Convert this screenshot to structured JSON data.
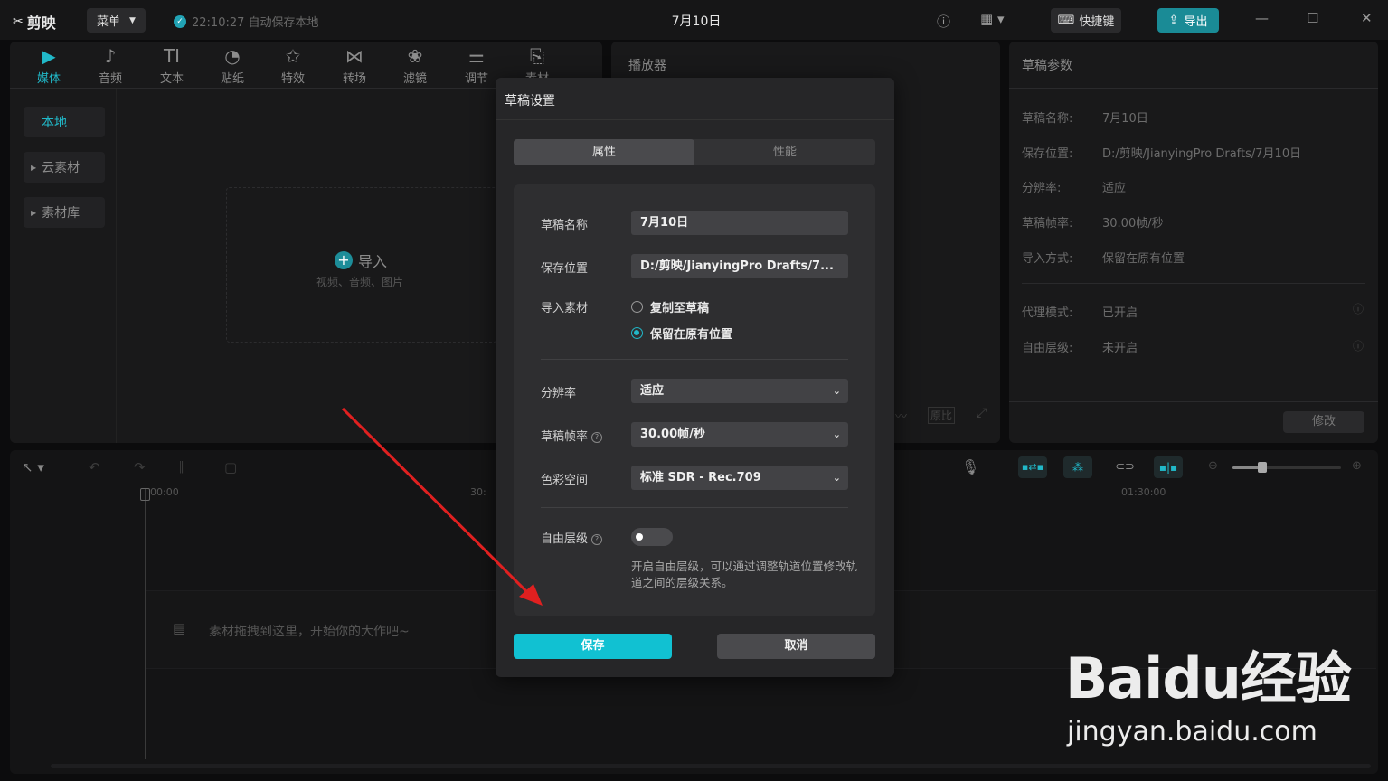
{
  "app": {
    "logo": "剪映",
    "menu": "菜单",
    "autosave": "22:10:27 自动保存本地",
    "title": "7月10日",
    "shortcut": "快捷键",
    "export": "导出"
  },
  "toolbar": [
    {
      "label": "媒体",
      "icon": "media-icon"
    },
    {
      "label": "音频",
      "icon": "audio-icon"
    },
    {
      "label": "文本",
      "icon": "text-icon"
    },
    {
      "label": "贴纸",
      "icon": "sticker-icon"
    },
    {
      "label": "特效",
      "icon": "effects-icon"
    },
    {
      "label": "转场",
      "icon": "transition-icon"
    },
    {
      "label": "滤镜",
      "icon": "filter-icon"
    },
    {
      "label": "调节",
      "icon": "adjust-icon"
    },
    {
      "label": "素材",
      "icon": "template-icon"
    }
  ],
  "sidebar": {
    "local": "本地",
    "cloud": "云素材",
    "library": "素材库"
  },
  "import": {
    "label": "导入",
    "hint": "视频、音频、图片"
  },
  "player": {
    "title": "播放器",
    "ratio": "原比"
  },
  "draft_params": {
    "title": "草稿参数",
    "rows": [
      {
        "k": "草稿名称:",
        "v": "7月10日"
      },
      {
        "k": "保存位置:",
        "v": "D:/剪映/JianyingPro Drafts/7月10日"
      },
      {
        "k": "分辨率:",
        "v": "适应"
      },
      {
        "k": "草稿帧率:",
        "v": "30.00帧/秒"
      },
      {
        "k": "导入方式:",
        "v": "保留在原有位置"
      },
      {
        "k": "代理模式:",
        "v": "已开启"
      },
      {
        "k": "自由层级:",
        "v": "未开启"
      }
    ],
    "modify": "修改"
  },
  "timeline": {
    "t0": "00:00",
    "t1": "30:",
    "t2": "01:30:00",
    "placeholder": "素材拖拽到这里，开始你的大作吧~"
  },
  "dialog": {
    "title": "草稿设置",
    "tab_props": "属性",
    "tab_perf": "性能",
    "name_label": "草稿名称",
    "name_value": "7月10日",
    "path_label": "保存位置",
    "path_value": "D:/剪映/JianyingPro Drafts/7...",
    "import_label": "导入素材",
    "opt_copy": "复制至草稿",
    "opt_keep": "保留在原有位置",
    "res_label": "分辨率",
    "res_value": "适应",
    "fps_label": "草稿帧率",
    "fps_value": "30.00帧/秒",
    "color_label": "色彩空间",
    "color_value": "标准 SDR - Rec.709",
    "layer_label": "自由层级",
    "layer_desc": "开启自由层级，可以通过调整轨道位置修改轨道之间的层级关系。",
    "save": "保存",
    "cancel": "取消"
  },
  "watermark": {
    "brand": "Baidu经验",
    "url": "jingyan.baidu.com"
  }
}
